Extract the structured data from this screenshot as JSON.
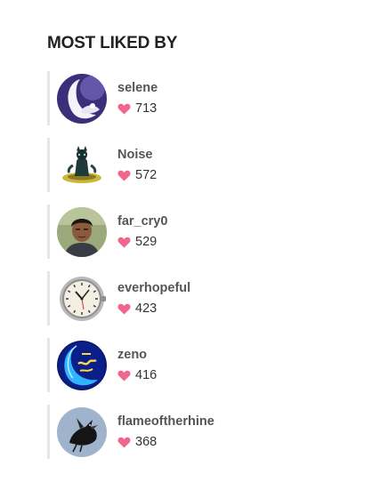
{
  "panel": {
    "title": "MOST LIKED BY"
  },
  "colors": {
    "heart": "#f0668c",
    "divider": "#e6e6e6",
    "username": "#555555",
    "count": "#333333"
  },
  "users": [
    {
      "username": "selene",
      "likes": "713",
      "avatar_icon": "crescent-moon-avatar-icon"
    },
    {
      "username": "Noise",
      "likes": "572",
      "avatar_icon": "figure-on-ufo-avatar-icon"
    },
    {
      "username": "far_cry0",
      "likes": "529",
      "avatar_icon": "person-photo-avatar-icon"
    },
    {
      "username": "everhopeful",
      "likes": "423",
      "avatar_icon": "wristwatch-avatar-icon"
    },
    {
      "username": "zeno",
      "likes": "416",
      "avatar_icon": "neon-moon-sign-avatar-icon"
    },
    {
      "username": "flameoftherhine",
      "likes": "368",
      "avatar_icon": "black-bird-avatar-icon"
    }
  ]
}
